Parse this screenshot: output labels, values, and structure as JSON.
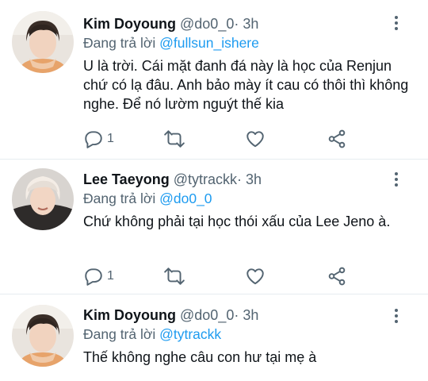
{
  "tweets": [
    {
      "name": "Kim Doyoung",
      "handle": "@do0_0",
      "separator": "·",
      "time": "3h",
      "reply_prefix": "Đang trả lời",
      "reply_to": "@fullsun_ishere",
      "text": "U là trời. Cái mặt đanh đá này là học của Renjun chứ có lạ đâu. Anh bảo mày ít cau có thôi thì không nghe. Để nó lườm nguýt thế kia",
      "reply_count": "1",
      "avatar_icon": "avatar-doyoung"
    },
    {
      "name": "Lee Taeyong",
      "handle": "@tytrackk",
      "separator": "·",
      "time": "3h",
      "reply_prefix": "Đang trả lời",
      "reply_to": "@do0_0",
      "text": "Chứ không phải tại học thói xấu của Lee Jeno à.",
      "reply_count": "1",
      "avatar_icon": "avatar-taeyong"
    },
    {
      "name": "Kim Doyoung",
      "handle": "@do0_0",
      "separator": "·",
      "time": "3h",
      "reply_prefix": "Đang trả lời",
      "reply_to": "@tytrackk",
      "text": "Thế không nghe câu con hư tại mẹ à",
      "reply_count": "",
      "avatar_icon": "avatar-doyoung"
    }
  ],
  "colors": {
    "mention": "#1d9bf0",
    "secondary": "#536471",
    "text": "#0f1419"
  }
}
